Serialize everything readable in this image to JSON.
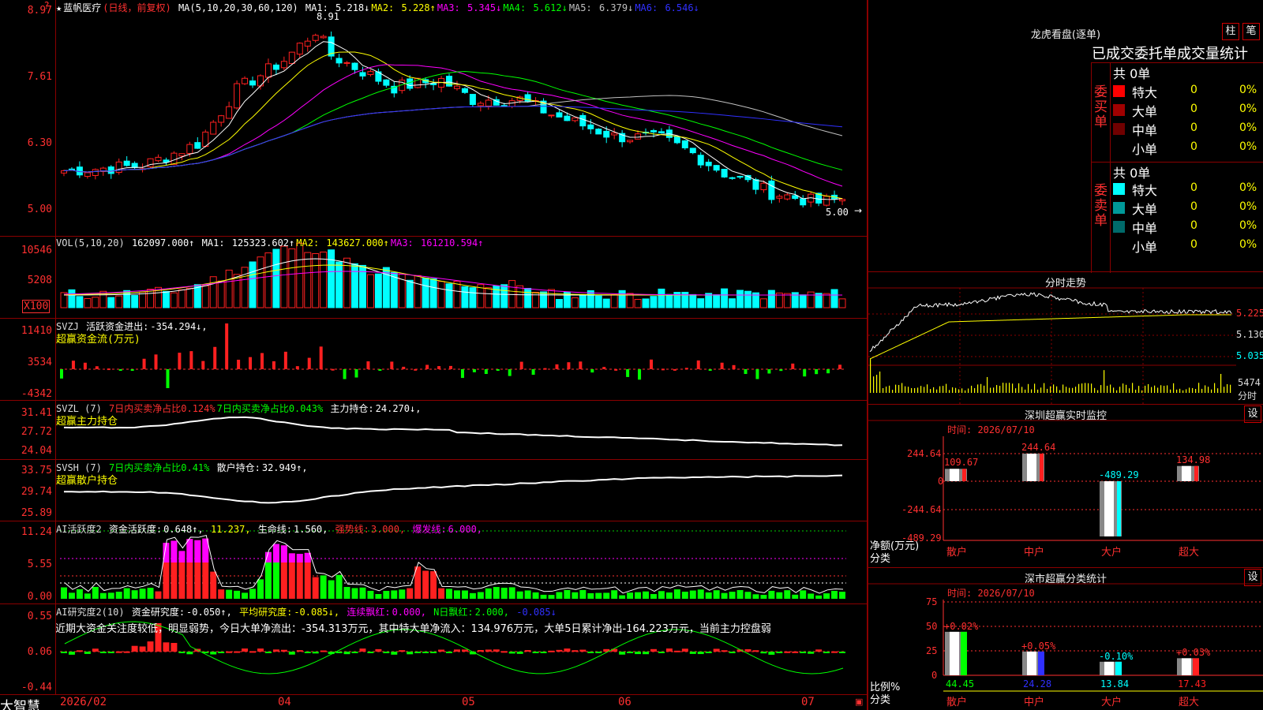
{
  "main": {
    "title_star": "★",
    "stock_name": "蓝帆医疗",
    "mode": "(日线，前复权)",
    "ma_params": "MA(5,10,20,30,60,120)",
    "ma": [
      {
        "label": "MA1:",
        "value": "5.218↓",
        "color": "#ffffff"
      },
      {
        "label": "MA2:",
        "value": "5.228↑",
        "color": "#ffff00"
      },
      {
        "label": "MA3:",
        "value": "5.345↓",
        "color": "#ff00ff"
      },
      {
        "label": "MA4:",
        "value": "5.612↓",
        "color": "#00ff00"
      },
      {
        "label": "MA5:",
        "value": "6.379↓",
        "color": "#c0c0c0"
      },
      {
        "label": "MA6:",
        "value": "6.546↓",
        "color": "#3030ff"
      }
    ],
    "y_ticks": [
      "8.97",
      "7.61",
      "6.30",
      "5.00"
    ],
    "high_label": "8.91",
    "low_label": "5.00"
  },
  "vol": {
    "header": "VOL(5,10,20)",
    "value": "162097.000↑",
    "ma": [
      {
        "label": "MA1:",
        "value": "125323.602↑",
        "color": "#ffffff"
      },
      {
        "label": "MA2:",
        "value": "143627.000↑",
        "color": "#ffff00"
      },
      {
        "label": "MA3:",
        "value": "161210.594↑",
        "color": "#ff00ff"
      }
    ],
    "y_ticks": [
      "10546",
      "5208"
    ],
    "unit_badge": "X100"
  },
  "svzj": {
    "header": "SVZJ",
    "label": "活跃资金进出:",
    "value": "-354.294↓,",
    "subtitle": "超赢资金流(万元)",
    "y_ticks": [
      "11410",
      "3534",
      "-4342"
    ]
  },
  "svzl": {
    "header": "SVZL (7)",
    "seg1": "7日内买卖净占比0.124%",
    "seg2": "7日内买卖净占比0.043%",
    "label": "主力持仓:",
    "value": "24.270↓,",
    "subtitle": "超赢主力持仓",
    "y_ticks": [
      "31.41",
      "27.72",
      "24.04"
    ]
  },
  "svsh": {
    "header": "SVSH (7)",
    "seg1": "7日内买卖净占比0.41%",
    "label": "散户持仓:",
    "value": "32.949↑,",
    "subtitle": "超赢散户持仓",
    "y_ticks": [
      "33.75",
      "29.74",
      "25.89"
    ]
  },
  "ai1": {
    "header": "AI活跃度2",
    "l1": "资金活跃度:",
    "v1": "0.648↑,",
    "v2": "11.237,",
    "l3": "生命线:",
    "v3": "1.560,",
    "l4": "强势线:",
    "v4": "3.000,",
    "l5": "爆发线:",
    "v5": "6.000,",
    "y_ticks": [
      "11.24",
      "5.55",
      "0.00"
    ]
  },
  "ai2": {
    "header": "AI研究度2(10)",
    "l1": "资金研究度:",
    "v1": "-0.050↑,",
    "l2": "平均研究度:",
    "v2": "-0.085↓,",
    "l3": "连续飘红:",
    "v3": "0.000,",
    "l4": "N日飘红:",
    "v4": "2.000,",
    "v5": "-0.085↓",
    "summary": "近期大资金关注度较低，明显弱势，今日大单净流出：-354.313万元，其中特大单净流入：134.976万元，大单5日累计净出-164.223万元，当前主力控盘弱",
    "y_ticks": [
      "0.55",
      "0.06",
      "-0.44"
    ]
  },
  "date_axis": {
    "brand": "大智慧",
    "labels": [
      "2026/02",
      "04",
      "05",
      "06",
      "07"
    ]
  },
  "dragon": {
    "title": "龙虎看盘(逐单)",
    "btn_bar": "柱",
    "btn_pen": "笔",
    "subtitle": "已成交委托单成交量统计",
    "buy_label": "委买单",
    "sell_label": "委卖单",
    "buy_total": "共 0单",
    "sell_total": "共 0单",
    "buy_rows": [
      {
        "name": "特大",
        "count": "0",
        "pct": "0%",
        "color": "#ff0000"
      },
      {
        "name": "大单",
        "count": "0",
        "pct": "0%",
        "color": "#a00000"
      },
      {
        "name": "中单",
        "count": "0",
        "pct": "0%",
        "color": "#700000"
      },
      {
        "name": "小单",
        "count": "0",
        "pct": "0%",
        "color": "#000000"
      }
    ],
    "sell_rows": [
      {
        "name": "特大",
        "count": "0",
        "pct": "0%",
        "color": "#00ffff"
      },
      {
        "name": "大单",
        "count": "0",
        "pct": "0%",
        "color": "#009999"
      },
      {
        "name": "中单",
        "count": "0",
        "pct": "0%",
        "color": "#006a6a"
      },
      {
        "name": "小单",
        "count": "0",
        "pct": "0%",
        "color": "#000000"
      }
    ]
  },
  "intraday": {
    "title": "分时走势",
    "price_ticks": [
      "5.225",
      "5.130",
      "5.035"
    ],
    "vol_tick": "5474",
    "vol_unit": "分时"
  },
  "monitor": {
    "title": "深圳超赢实时监控",
    "btn": "设",
    "time": "时间: 2026/07/10",
    "y_ticks": [
      "244.64",
      "0",
      "-244.64",
      "-489.29"
    ],
    "y_label": "净额(万元)",
    "x_label": "分类",
    "categories": [
      "散户",
      "中户",
      "大户",
      "超大"
    ],
    "values": [
      109.67,
      244.64,
      -489.29,
      134.98
    ],
    "value_labels": [
      "109.67",
      "244.64",
      "-489.29",
      "134.98"
    ]
  },
  "classify": {
    "title": "深市超赢分类统计",
    "btn": "设",
    "time": "时间: 2026/07/10",
    "y_ticks": [
      "75",
      "50",
      "25",
      "0"
    ],
    "y_label": "比例%",
    "x_label": "分类",
    "categories": [
      "散户",
      "中户",
      "大户",
      "超大"
    ],
    "values": [
      44.45,
      24.28,
      13.84,
      17.43
    ],
    "changes": [
      "+0.02%",
      "+0.05%",
      "-0.10%",
      "+0.03%"
    ],
    "colors": [
      "#00ff00",
      "#3030ff",
      "#00ffff",
      "#ff2020"
    ]
  }
}
